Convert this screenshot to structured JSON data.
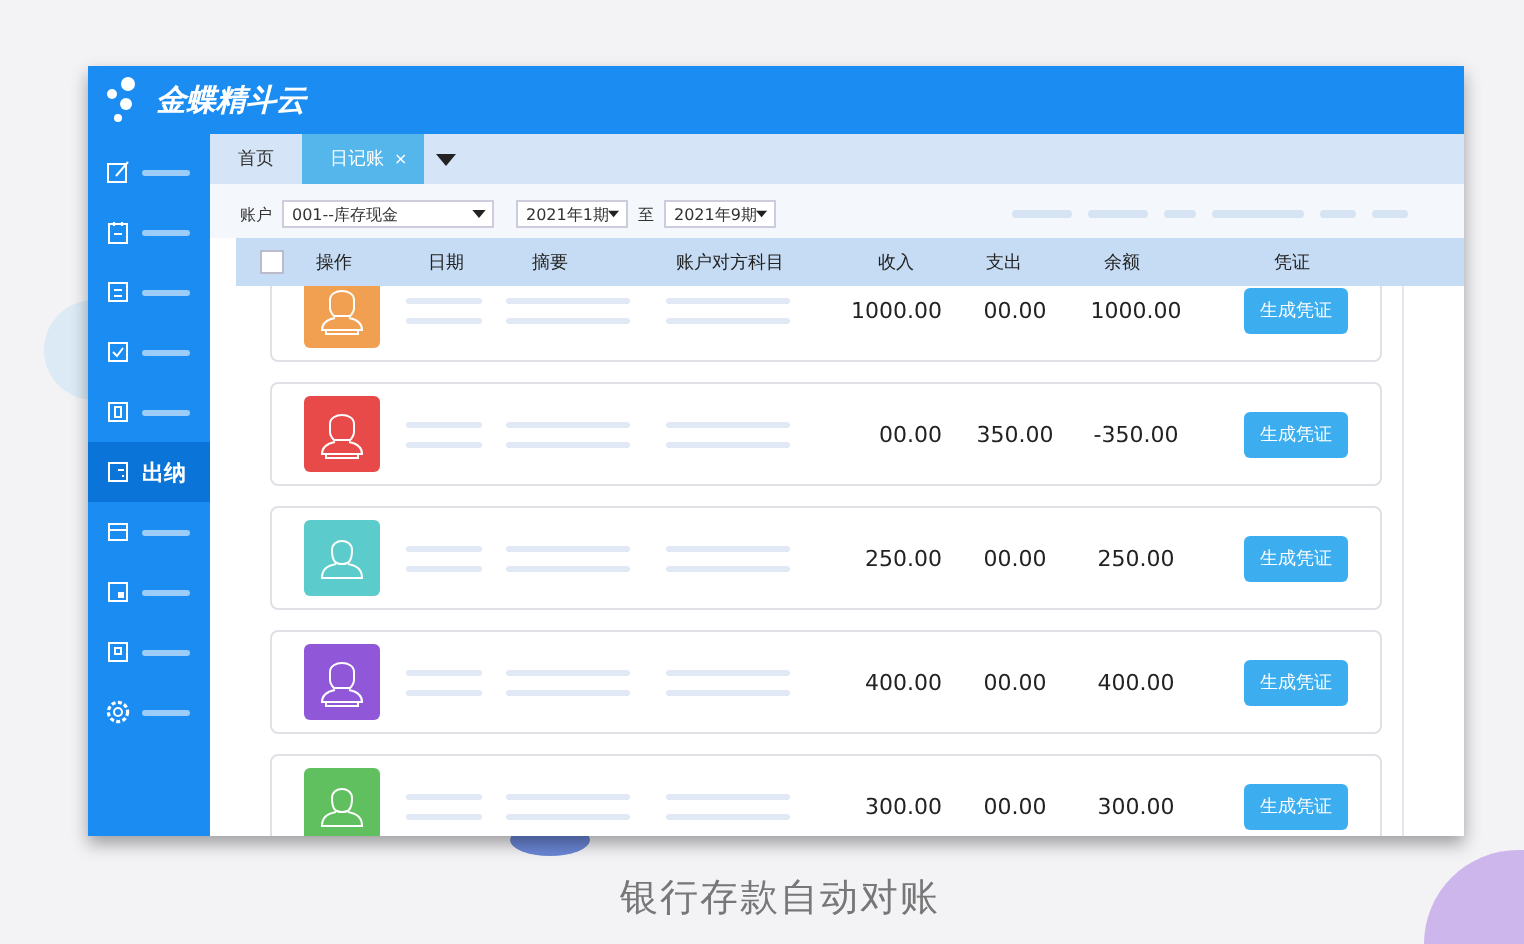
{
  "app": {
    "logo_text": "金蝶精斗云"
  },
  "sidebar": {
    "items": [
      {
        "selected": false
      },
      {
        "selected": false
      },
      {
        "selected": false
      },
      {
        "selected": false
      },
      {
        "selected": false
      },
      {
        "label": "出纳",
        "selected": true
      },
      {
        "selected": false
      },
      {
        "selected": false
      },
      {
        "selected": false
      },
      {
        "selected": false
      }
    ]
  },
  "tabs": [
    {
      "label": "首页",
      "selected": false
    },
    {
      "label": "日记账",
      "selected": true,
      "close": "×"
    }
  ],
  "filters": {
    "account_label": "账户",
    "account": "001--库存现金",
    "period_from": "2021年1期",
    "separator": "至",
    "period_to": "2021年9期"
  },
  "table": {
    "select_all": {
      "checked": false
    },
    "columns": [
      "操作",
      "日期",
      "摘要",
      "账户对方科目",
      "收入",
      "支出",
      "余额",
      "凭证"
    ],
    "rows": [
      {
        "avatar": {
          "color": "#f0a050",
          "kind": "female"
        },
        "income": "1000.00",
        "expense": "00.00",
        "balance": "1000.00",
        "action": "生成凭证"
      },
      {
        "avatar": {
          "color": "#e84a4a",
          "kind": "female"
        },
        "income": "00.00",
        "expense": "350.00",
        "balance": "-350.00",
        "action": "生成凭证"
      },
      {
        "avatar": {
          "color": "#5ccbcb",
          "kind": "male"
        },
        "income": "250.00",
        "expense": "00.00",
        "balance": "250.00",
        "action": "生成凭证"
      },
      {
        "avatar": {
          "color": "#9058d8",
          "kind": "female"
        },
        "income": "400.00",
        "expense": "00.00",
        "balance": "400.00",
        "action": "生成凭证"
      },
      {
        "avatar": {
          "color": "#60c060",
          "kind": "male"
        },
        "income": "300.00",
        "expense": "00.00",
        "balance": "300.00",
        "action": "生成凭证"
      }
    ]
  },
  "caption": "银行存款自动对账"
}
